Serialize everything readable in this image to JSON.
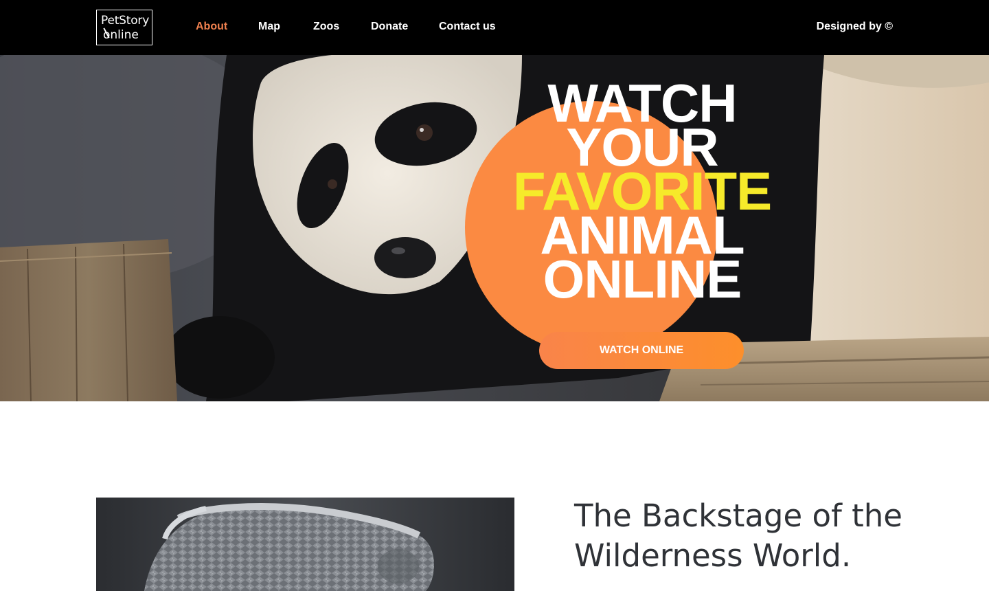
{
  "header": {
    "logo": {
      "line1": "PetStory",
      "line2": "online"
    },
    "nav": [
      {
        "label": "About",
        "active": true
      },
      {
        "label": "Map",
        "active": false
      },
      {
        "label": "Zoos",
        "active": false
      },
      {
        "label": "Donate",
        "active": false
      },
      {
        "label": "Contact us",
        "active": false
      }
    ],
    "designed_by": "Designed by ©"
  },
  "hero": {
    "title_lines": [
      "WATCH",
      "YOUR",
      "FAVORITE",
      "ANIMAL",
      "ONLINE"
    ],
    "highlight_line": "FAVORITE",
    "button_label": "WATCH ONLINE",
    "image": "giant-panda-photo"
  },
  "section": {
    "title": "The Backstage of the Wilderness World.",
    "image": "monochrome-basket-photo"
  },
  "colors": {
    "header_bg": "#000000",
    "nav_active": "#f0814f",
    "accent_orange": "#fb8a42",
    "highlight_yellow": "#f6ea2a",
    "button_gradient_start": "#f9844a",
    "button_gradient_end": "#fd8f2b",
    "section_text": "#2f3237"
  }
}
